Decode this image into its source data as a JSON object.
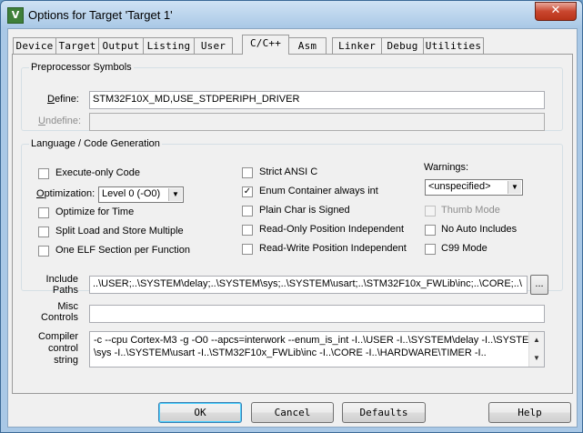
{
  "window": {
    "title": "Options for Target 'Target 1'",
    "app_icon": "keil-uvision-icon",
    "close_glyph": "✕"
  },
  "tabs": [
    {
      "label": "Device"
    },
    {
      "label": "Target"
    },
    {
      "label": "Output"
    },
    {
      "label": "Listing"
    },
    {
      "label": "User"
    },
    {
      "label": "C/C++",
      "active": true
    },
    {
      "label": "Asm"
    },
    {
      "label": "Linker"
    },
    {
      "label": "Debug"
    },
    {
      "label": "Utilities"
    }
  ],
  "preprocessor": {
    "legend": "Preprocessor Symbols",
    "define_label": "Define:",
    "define_value": "STM32F10X_MD,USE_STDPERIPH_DRIVER",
    "undefine_label": "Undefine:",
    "undefine_value": ""
  },
  "codegen": {
    "legend": "Language / Code Generation",
    "execute_only": "Execute-only Code",
    "optimization_label": "Optimization:",
    "optimization_value": "Level 0 (-O0)",
    "optimize_time": "Optimize for Time",
    "split_load": "Split Load and Store Multiple",
    "one_elf": "One ELF Section per Function",
    "strict_ansi": "Strict ANSI C",
    "enum_container": "Enum Container always int",
    "plain_char": "Plain Char is Signed",
    "ro_pi": "Read-Only Position Independent",
    "rw_pi": "Read-Write Position Independent",
    "warnings_label": "Warnings:",
    "warnings_value": "<unspecified>",
    "thumb_mode": "Thumb Mode",
    "no_auto_includes": "No Auto Includes",
    "c99_mode": "C99 Mode",
    "enum_checked": true
  },
  "include": {
    "label_line1": "Include",
    "label_line2": "Paths",
    "value": "..\\USER;..\\SYSTEM\\delay;..\\SYSTEM\\sys;..\\SYSTEM\\usart;..\\STM32F10x_FWLib\\inc;..\\CORE;..\\",
    "browse": "..."
  },
  "misc": {
    "label_line1": "Misc",
    "label_line2": "Controls",
    "value": ""
  },
  "compiler": {
    "label_line1": "Compiler",
    "label_line2": "control",
    "label_line3": "string",
    "line1": "-c --cpu Cortex-M3 -g -O0 --apcs=interwork --enum_is_int -I..\\USER -I..\\SYSTEM\\delay -I..\\SYSTEM",
    "line2": "\\sys -I..\\SYSTEM\\usart -I..\\STM32F10x_FWLib\\inc -I..\\CORE -I..\\HARDWARE\\TIMER -I.."
  },
  "buttons": {
    "ok": "OK",
    "cancel": "Cancel",
    "defaults": "Defaults",
    "help": "Help"
  }
}
